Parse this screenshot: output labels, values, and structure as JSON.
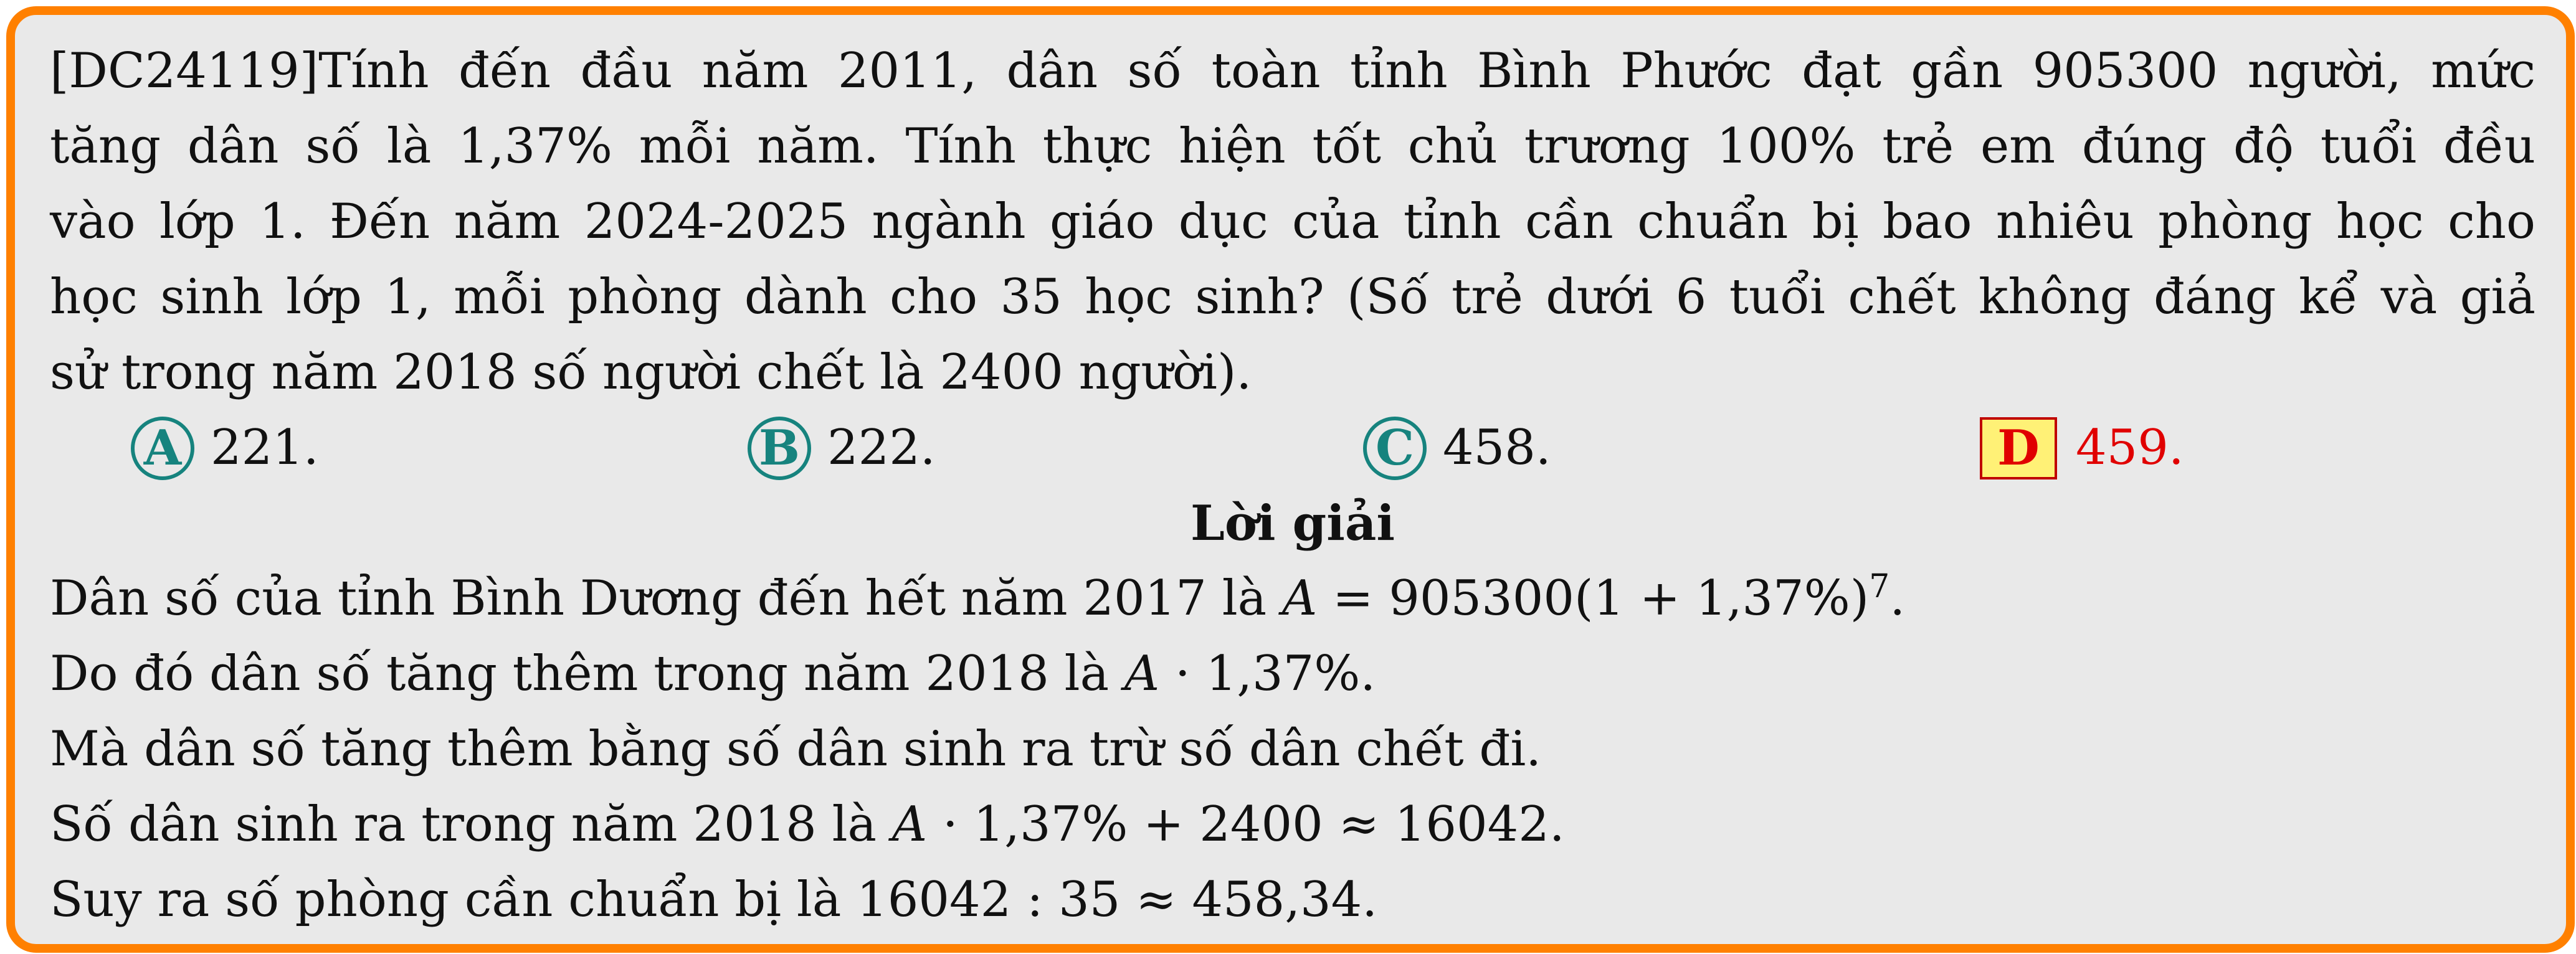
{
  "question": {
    "lines": [
      "[DC24119]Tính đến đầu năm 2011, dân số toàn tỉnh Bình Phước đạt gần 905300 người, mức",
      "tăng dân số là 1,37% mỗi năm. Tính thực hiện tốt chủ trương 100% trẻ em đúng độ tuổi đều",
      "vào lớp 1. Đến năm 2024-2025 ngành giáo dục của tỉnh cần chuẩn bị bao nhiêu phòng học cho",
      "học sinh lớp 1, mỗi phòng dành cho 35 học sinh? (Số trẻ dưới 6 tuổi chết không đáng kể và giả",
      "sử trong năm 2018 số người chết là 2400 người)."
    ]
  },
  "choices": [
    {
      "letter": "A",
      "value": "221."
    },
    {
      "letter": "B",
      "value": "222."
    },
    {
      "letter": "C",
      "value": "458."
    },
    {
      "letter": "D",
      "value": "459.",
      "correct": true
    }
  ],
  "solution": {
    "title": "Lời giải",
    "line1_pre": "Dân số của tỉnh Bình Dương đến hết năm 2017 là ",
    "line1_var": "A",
    "line1_mid": " = 905300(1 + 1,37%)",
    "line1_exp": "7",
    "line1_post": ".",
    "line2_pre": "Do đó dân số tăng thêm trong năm 2018 là ",
    "line2_var": "A",
    "line2_post": " · 1,37%.",
    "line3": "Mà dân số tăng thêm bằng số dân sinh ra trừ số dân chết đi.",
    "line4_pre": "Số dân sinh ra trong năm 2018 là ",
    "line4_var": "A",
    "line4_post": " · 1,37% + 2400 ≈ 16042.",
    "line5": "Suy ra số phòng cần chuẩn bị là 16042 : 35 ≈ 458,34."
  },
  "colors": {
    "frame_border": "#ff8000",
    "background": "#e9e9e9",
    "choice_teal": "#16837e",
    "correct_red": "#e00000",
    "correct_box_fill": "#fff176"
  }
}
